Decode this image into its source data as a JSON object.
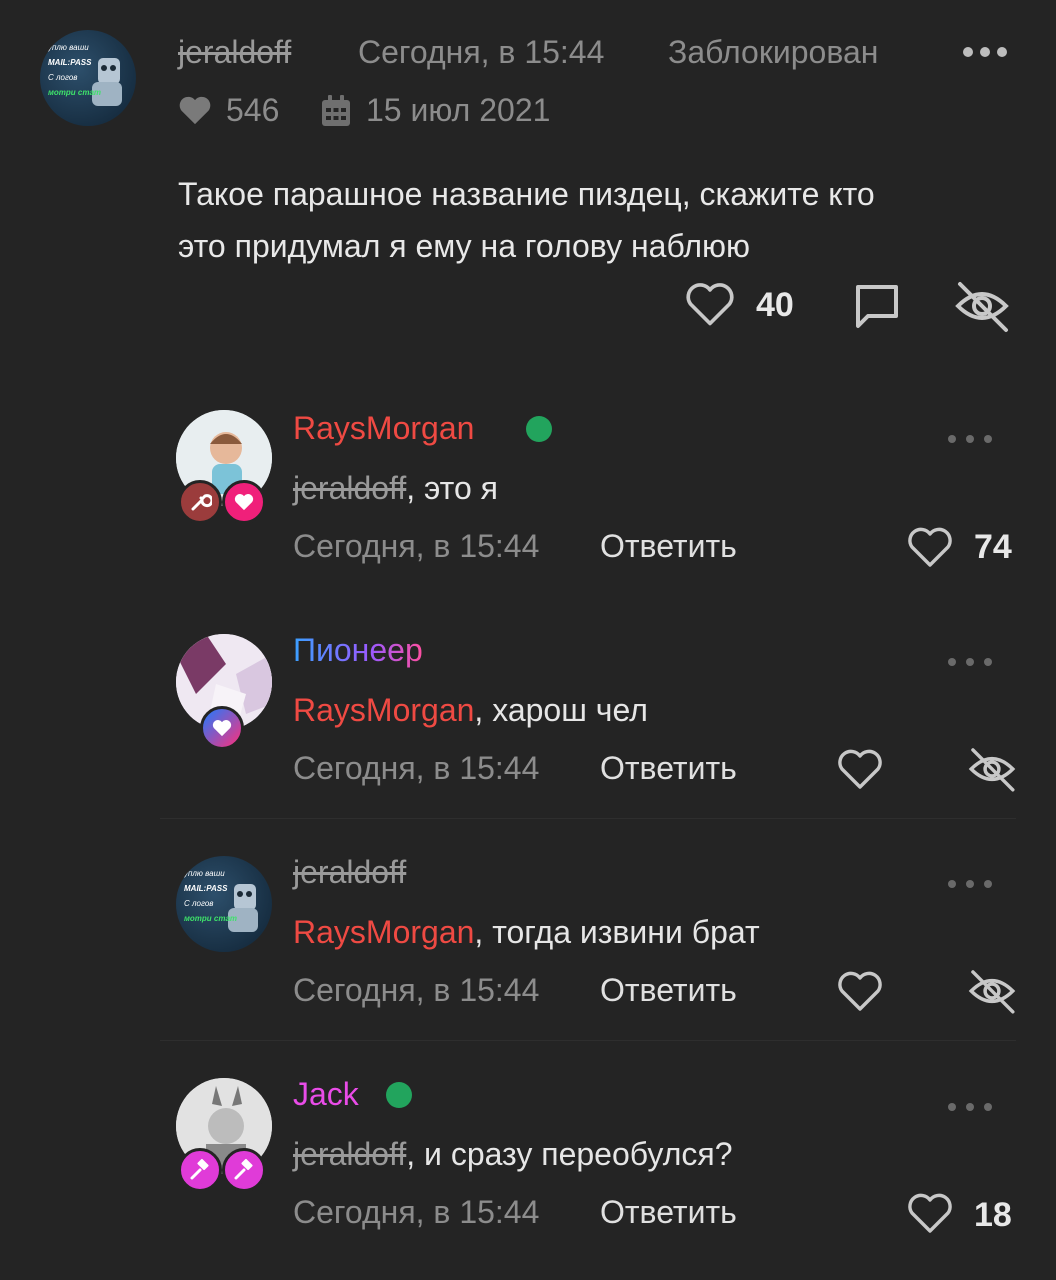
{
  "post": {
    "author": "jeraldoff",
    "time": "Сегодня, в 15:44",
    "status": "Заблокирован",
    "likes": "546",
    "reg_date": "15 июл 2021",
    "text_line1": "Такое парашное название пиздец, скажите кто",
    "text_line2": "это придумал я ему на голову наблюю",
    "like_count": "40",
    "avatar_text": [
      "уплю ваши",
      "MAIL:PASS",
      "С логов",
      "мотри стат"
    ]
  },
  "comments": [
    {
      "author": "RaysMorgan",
      "online": true,
      "mention": "jeraldoff",
      "text": ", это я",
      "time": "Сегодня, в 15:44",
      "reply": "Ответить",
      "likes": "74"
    },
    {
      "author": "Пионеер",
      "mention": "RaysMorgan",
      "text": ", харош чел",
      "time": "Сегодня, в 15:44",
      "reply": "Ответить"
    },
    {
      "author": "jeraldoff",
      "mention": "RaysMorgan",
      "text": ", тогда извини брат",
      "time": "Сегодня, в 15:44",
      "reply": "Ответить"
    },
    {
      "author": "Jack",
      "online": true,
      "mention": "jeraldoff",
      "text": ", и сразу переобулся?",
      "time": "Сегодня, в 15:44",
      "reply": "Ответить",
      "likes": "18"
    }
  ],
  "colors": {
    "background": "#242424",
    "muted": "#8c8c8c",
    "accent_red": "#ef4a43",
    "online_green": "#22a45d",
    "magenta": "#e94ce8"
  }
}
